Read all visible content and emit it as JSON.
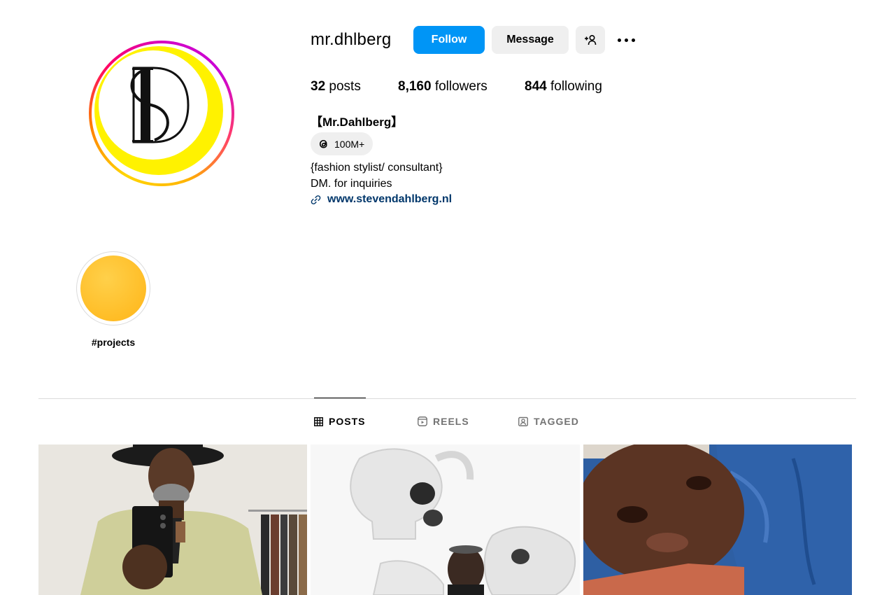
{
  "profile": {
    "username": "mr.dhlberg",
    "full_name": "【Mr.Dahlberg】",
    "threads_badge": "100M+",
    "bio_lines": [
      "{fashion stylist/ consultant}",
      "DM. for inquiries"
    ],
    "link": "www.stevendahlberg.nl"
  },
  "actions": {
    "follow_label": "Follow",
    "message_label": "Message"
  },
  "stats": {
    "posts_count": "32",
    "posts_label": "posts",
    "followers_count": "8,160",
    "followers_label": "followers",
    "following_count": "844",
    "following_label": "following"
  },
  "highlights": [
    {
      "label": "#projects",
      "color": "#ffbd26"
    }
  ],
  "tabs": [
    {
      "label": "POSTS",
      "icon": "grid-icon",
      "active": true
    },
    {
      "label": "REELS",
      "icon": "reels-icon",
      "active": false
    },
    {
      "label": "TAGGED",
      "icon": "tagged-icon",
      "active": false
    }
  ],
  "colors": {
    "accent": "#0095f6",
    "link": "#00376b",
    "muted": "#737373",
    "button_bg": "#efefef"
  }
}
